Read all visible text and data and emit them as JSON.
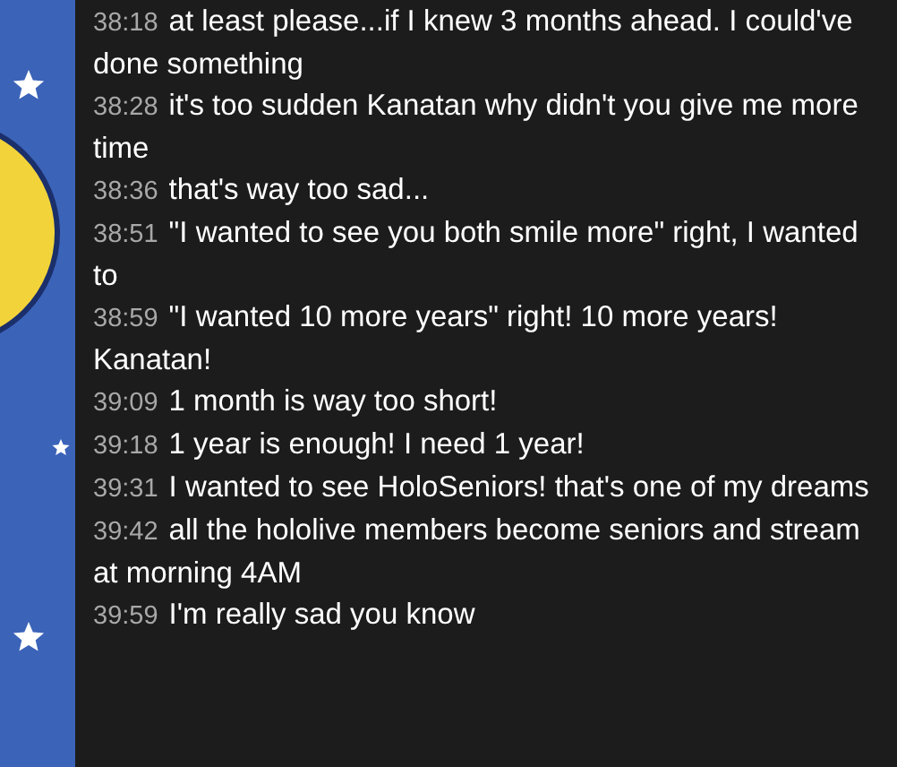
{
  "chat": {
    "messages": [
      {
        "time": "38:18",
        "text": "at least please...if I knew 3 months ahead. I could've done something"
      },
      {
        "time": "38:28",
        "text": "it's too sudden Kanatan why didn't you give me more time"
      },
      {
        "time": "38:36",
        "text": "that's way too sad..."
      },
      {
        "time": "38:51",
        "text": "\"I wanted to see you both smile more\" right, I wanted to"
      },
      {
        "time": "38:59",
        "text": "\"I wanted 10 more years\" right! 10 more years! Kanatan!"
      },
      {
        "time": "39:09",
        "text": "1 month is way too short!"
      },
      {
        "time": "39:18",
        "text": "1 year is enough! I need 1 year!"
      },
      {
        "time": "39:31",
        "text": "I wanted to see HoloSeniors! that's one of my dreams"
      },
      {
        "time": "39:42",
        "text": "all the hololive members become seniors and stream at morning 4AM"
      },
      {
        "time": "39:59",
        "text": "I'm really sad you know"
      }
    ]
  }
}
